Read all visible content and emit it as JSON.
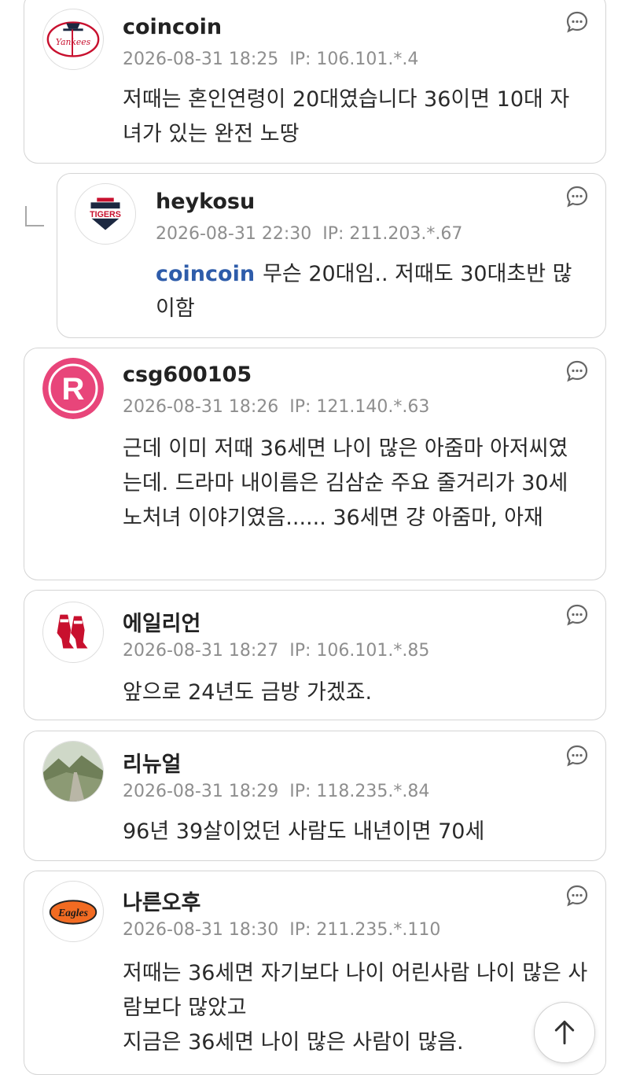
{
  "comments": [
    {
      "nickname": "coincoin",
      "date": "2026-08-31 18:25",
      "ip": "IP: 106.101.*.4",
      "text": "저때는 혼인연령이 20대였습니다 36이면 10대 자녀가 있는 완전 노땅",
      "avatar": "yankees-logo"
    },
    {
      "nickname": "heykosu",
      "date": "2026-08-31 22:30",
      "ip": "IP: 211.203.*.67",
      "mention": "coincoin",
      "text": "무슨 20대임.. 저때도 30대초반 많이함",
      "avatar": "tigers-logo",
      "avatar_text": "TIGERS",
      "is_reply": true
    },
    {
      "nickname": "csg600105",
      "date": "2026-08-31 18:26",
      "ip": "IP: 121.140.*.63",
      "text": "근데 이미 저때 36세면 나이 많은 아줌마 아저씨였는데. 드라마 내이름은 김삼순 주요 줄거리가 30세 노처녀 이야기였음...... 36세면 걍 아줌마, 아재",
      "avatar": "r-logo",
      "avatar_text": "R"
    },
    {
      "nickname": "에일리언",
      "date": "2026-08-31 18:27",
      "ip": "IP: 106.101.*.85",
      "text": "앞으로 24년도 금방 가겠죠.",
      "avatar": "red-sox-logo"
    },
    {
      "nickname": "리뉴얼",
      "date": "2026-08-31 18:29",
      "ip": "IP: 118.235.*.84",
      "text": "96년 39살이었던 사람도 내년이면 70세",
      "avatar": "landscape-photo"
    },
    {
      "nickname": "나른오후",
      "date": "2026-08-31 18:30",
      "ip": "IP: 211.235.*.110",
      "text": "저때는 36세면 자기보다 나이 어린사람 나이 많은 사람보다 많았고\n지금은 36세면 나이 많은 사람이 많음.",
      "avatar": "eagles-logo",
      "avatar_text": "Eagles"
    }
  ],
  "icons": {
    "comment_more": "speech-bubble-dots-icon",
    "scroll_top": "arrow-up-icon",
    "reply": "reply-corner-icon"
  },
  "colors": {
    "mention": "#2e5caa",
    "meta_text": "#8e8e8e",
    "card_border": "#d4d4d4"
  }
}
